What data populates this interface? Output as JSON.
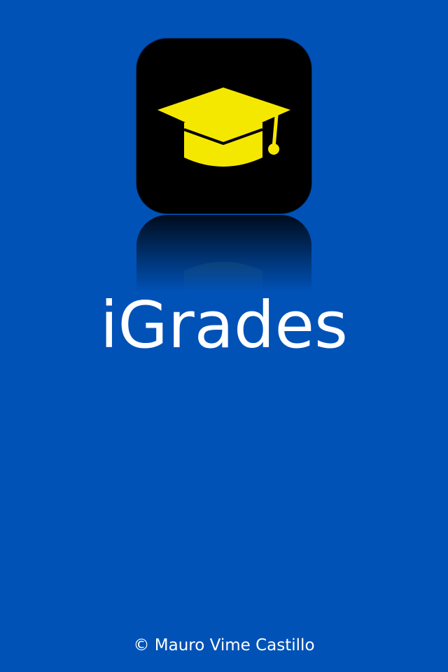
{
  "app": {
    "title": "iGrades",
    "icon": "graduation-cap-icon"
  },
  "footer": {
    "copyright": "© Mauro Vime Castillo"
  },
  "colors": {
    "background": "#0052b7",
    "icon_background": "#000000",
    "icon_glyph": "#f5e800",
    "text": "#ffffff"
  }
}
